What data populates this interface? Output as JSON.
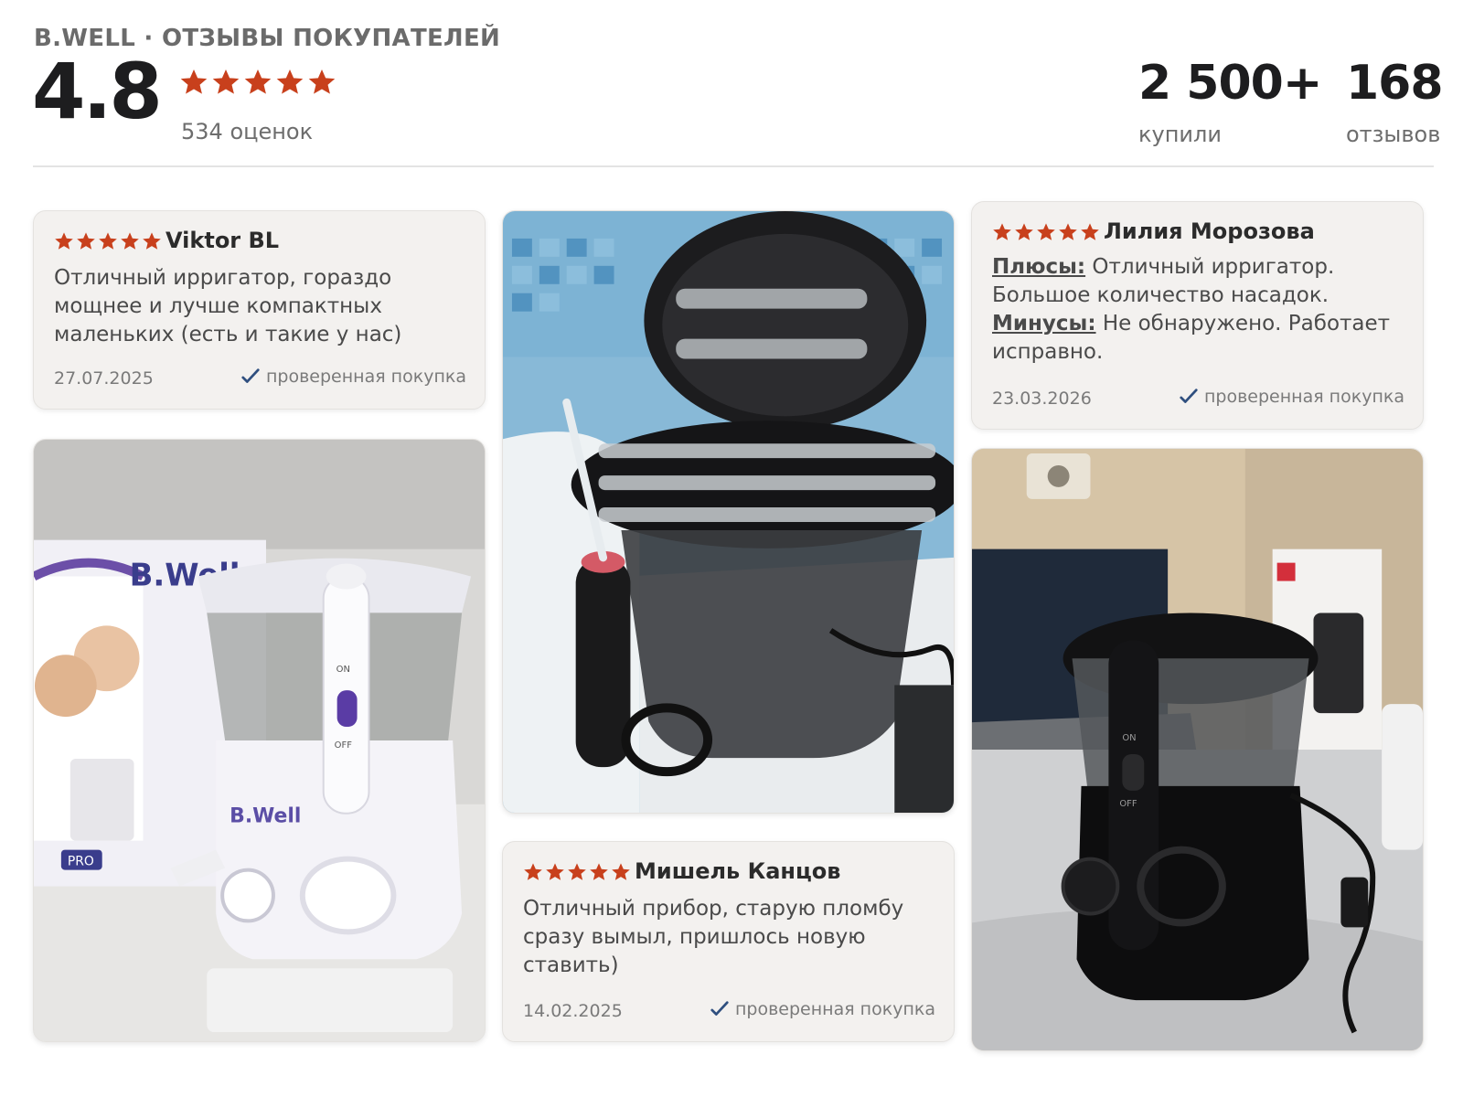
{
  "header": {
    "brand_line": "B.WELL · ОТЗЫВЫ ПОКУПАТЕЛЕЙ",
    "rating": "4.8",
    "rating_stars": 5,
    "ratings_count": "534 оценок",
    "bought_value": "2 500+",
    "bought_label": "купили",
    "reviews_value": "168",
    "reviews_label": "отзывов"
  },
  "reviews": [
    {
      "stars": 5,
      "author": "Viktor BL",
      "text": "Отличный ирригатор, гораздо мощнее и лучше компактных маленьких (есть и такие у нас)",
      "date": "27.07.2025",
      "verified": "проверенная покупка"
    },
    {
      "stars": 5,
      "author": "Мишель Канцов",
      "text": "Отличный прибор, старую пломбу сразу вымыл, пришлось новую ставить)",
      "date": "14.02.2025",
      "verified": "проверенная покупка"
    },
    {
      "stars": 5,
      "author": "Лилия Морозова",
      "pros_label": "Плюсы:",
      "pros_text": "Отличный ирригатор. Большое количество насадок.",
      "cons_label": "Минусы:",
      "cons_text": "Не обнаружено. Работает исправно.",
      "date": "23.03.2026",
      "verified": "проверенная покупка"
    }
  ],
  "photos": {
    "white_irrigator": {
      "box_brand": "B.Well",
      "device_brand": "B.Well",
      "switch_on": "ON",
      "switch_off": "OFF",
      "box_badge": "PRO"
    },
    "black_irrigator_open": {},
    "black_irrigator_table": {
      "switch_on": "ON",
      "switch_off": "OFF"
    }
  },
  "colors": {
    "star": "#c8401c",
    "check": "#2f4f7f",
    "card_bg": "#f3f1ef"
  }
}
